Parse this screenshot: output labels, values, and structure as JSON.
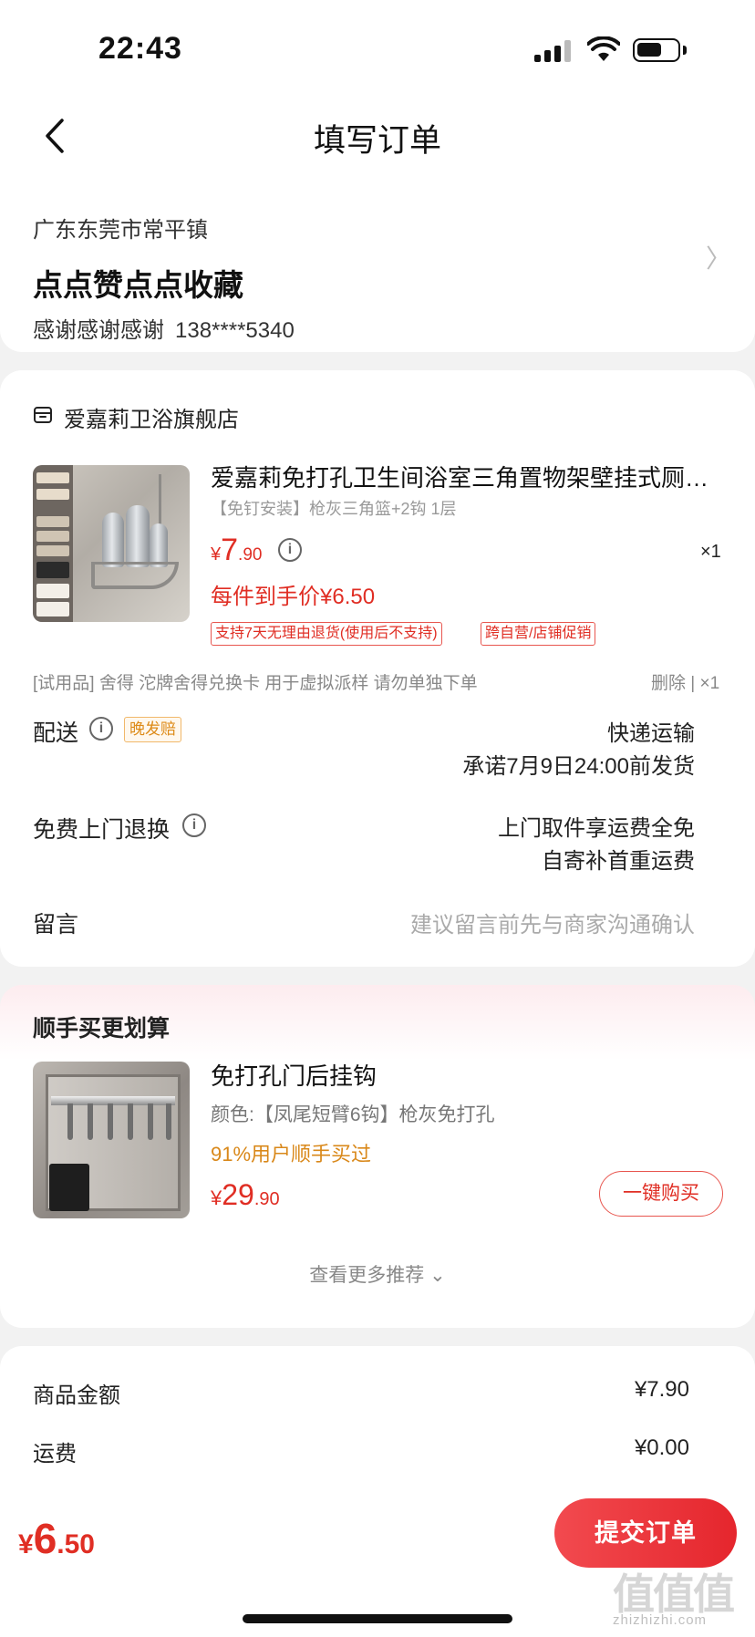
{
  "status_bar": {
    "time": "22:43"
  },
  "header": {
    "title": "填写订单"
  },
  "address": {
    "region": "广东东莞市常平镇",
    "detail": "点点赞点点收藏",
    "name": "感谢感谢感谢",
    "phone": "138****5340",
    "chevron": "〉"
  },
  "store": {
    "name": "爱嘉莉卫浴旗舰店",
    "icon": "store-icon",
    "product": {
      "title": "爱嘉莉免打孔卫生间浴室三角置物架壁挂式厕所...",
      "spec": "【免钉安装】枪灰三角篮+2钩 1层",
      "price_yen": "¥",
      "price_int": "7",
      "price_dec": ".90",
      "quantity": "×1",
      "final_price": "每件到手价¥6.50",
      "tags": [
        "支持7天无理由退货(使用后不支持)",
        "跨自营/店铺促销"
      ]
    },
    "trial": {
      "text": "[试用品] 舍得 沱牌舍得兑换卡 用于虚拟派样 请勿单独下单",
      "action": "删除 | ×1"
    },
    "delivery": {
      "label": "配送",
      "badge": "晚发赔",
      "method": "快递运输",
      "promise": "承诺7月9日24:00前发货"
    },
    "returns": {
      "label": "免费上门退换",
      "line1": "上门取件享运费全免",
      "line2": "自寄补首重运费"
    },
    "message": {
      "label": "留言",
      "placeholder": "建议留言前先与商家沟通确认"
    }
  },
  "recommend": {
    "title": "顺手买更划算",
    "product": {
      "name": "免打孔门后挂钩",
      "spec": "颜色:【凤尾短臂6钩】枪灰免打孔",
      "stat": "91%用户顺手买过",
      "price_yen": "¥",
      "price_int": "29",
      "price_dec": ".90",
      "buy_label": "一键购买"
    },
    "more_label": "查看更多推荐 ⌄"
  },
  "summary": {
    "goods_label": "商品金额",
    "goods_value": "¥7.90",
    "shipping_label": "运费",
    "shipping_value": "¥0.00"
  },
  "bottom": {
    "total_yen": "¥",
    "total_int": "6",
    "total_dec": ".50",
    "submit_label": "提交订单"
  },
  "watermark": {
    "logo": "值值值",
    "site": "zhizhizhi.com"
  },
  "colors": {
    "accent": "#e02e24",
    "orange": "#d9881a",
    "gray_text": "#999999"
  }
}
